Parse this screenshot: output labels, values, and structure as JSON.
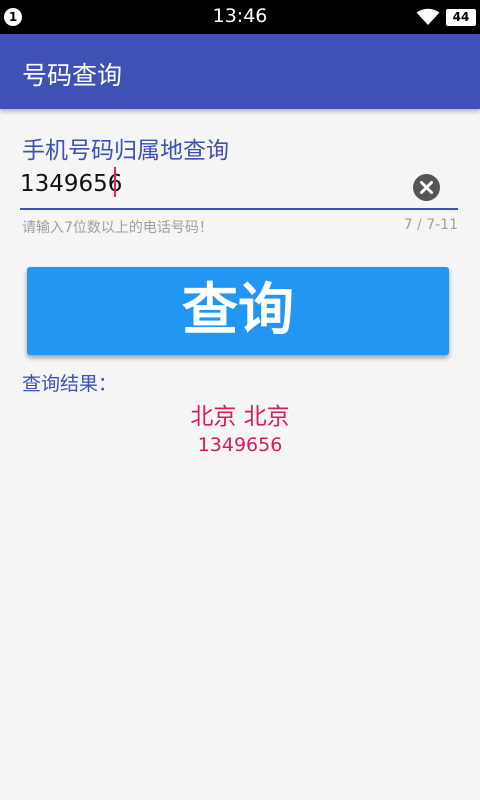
{
  "status_bar": {
    "notification_count": "1",
    "time": "13:46",
    "wifi_icon": "wifi-icon",
    "battery_level": "44"
  },
  "app_bar": {
    "title": "号码查询",
    "color": "#3f51b5"
  },
  "form": {
    "label": "手机号码归属地查询",
    "input_value": "1349656",
    "helper_text": "请输入7位数以上的电话号码！",
    "counter": "7 / 7-11",
    "clear_icon": "clear-icon",
    "accent_color": "#3f51b5",
    "cursor_color": "#e91e63"
  },
  "query_button": {
    "label": "查询",
    "color": "#2196f3"
  },
  "result": {
    "label": "查询结果：",
    "location": "北京 北京",
    "number": "1349656",
    "color": "#d81b60"
  }
}
